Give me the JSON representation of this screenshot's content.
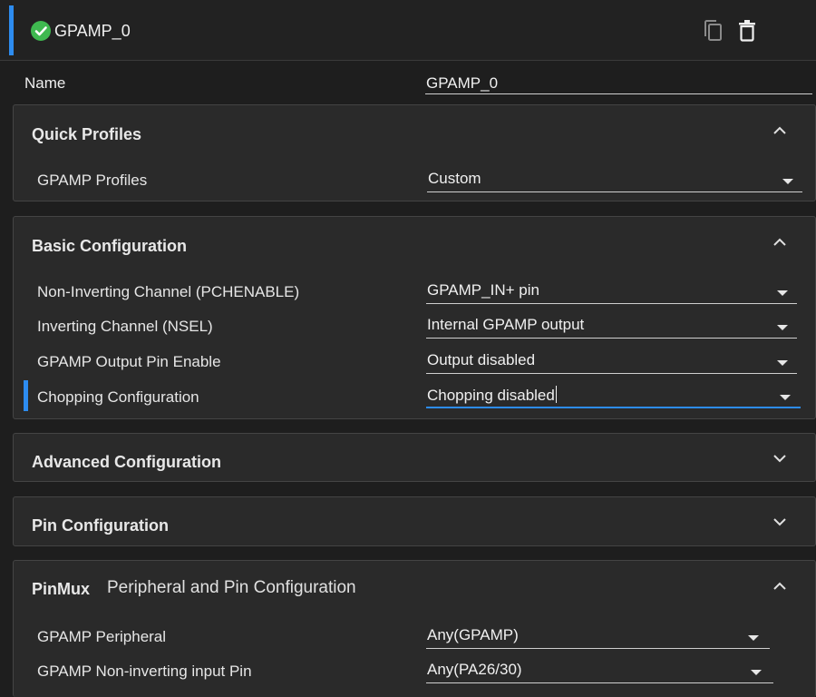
{
  "header": {
    "title": "GPAMP_0",
    "status_icon": "check-circle-icon",
    "status_color": "#3fb950",
    "accent_color": "#2d8cf0",
    "actions": [
      "copy-icon",
      "trash-icon"
    ]
  },
  "name_field": {
    "label": "Name",
    "value": "GPAMP_0"
  },
  "quick_profiles": {
    "title": "Quick Profiles",
    "expanded": true,
    "rows": [
      {
        "label": "GPAMP Profiles",
        "value": "Custom"
      }
    ]
  },
  "basic_configuration": {
    "title": "Basic Configuration",
    "expanded": true,
    "rows": [
      {
        "label": "Non-Inverting Channel (PCHENABLE)",
        "value": "GPAMP_IN+ pin"
      },
      {
        "label": "Inverting Channel (NSEL)",
        "value": "Internal GPAMP output"
      },
      {
        "label": "GPAMP Output Pin Enable",
        "value": "Output disabled"
      },
      {
        "label": "Chopping Configuration",
        "value": "Chopping disabled"
      }
    ]
  },
  "advanced_configuration": {
    "title": "Advanced Configuration",
    "expanded": false
  },
  "pin_configuration": {
    "title": "Pin Configuration",
    "expanded": false
  },
  "pinmux": {
    "title": "PinMux",
    "subtitle": "Peripheral and Pin Configuration",
    "expanded": true,
    "rows": [
      {
        "label": "GPAMP Peripheral",
        "value": "Any(GPAMP)"
      },
      {
        "label": "GPAMP Non-inverting input Pin",
        "value": "Any(PA26/30)"
      }
    ]
  }
}
